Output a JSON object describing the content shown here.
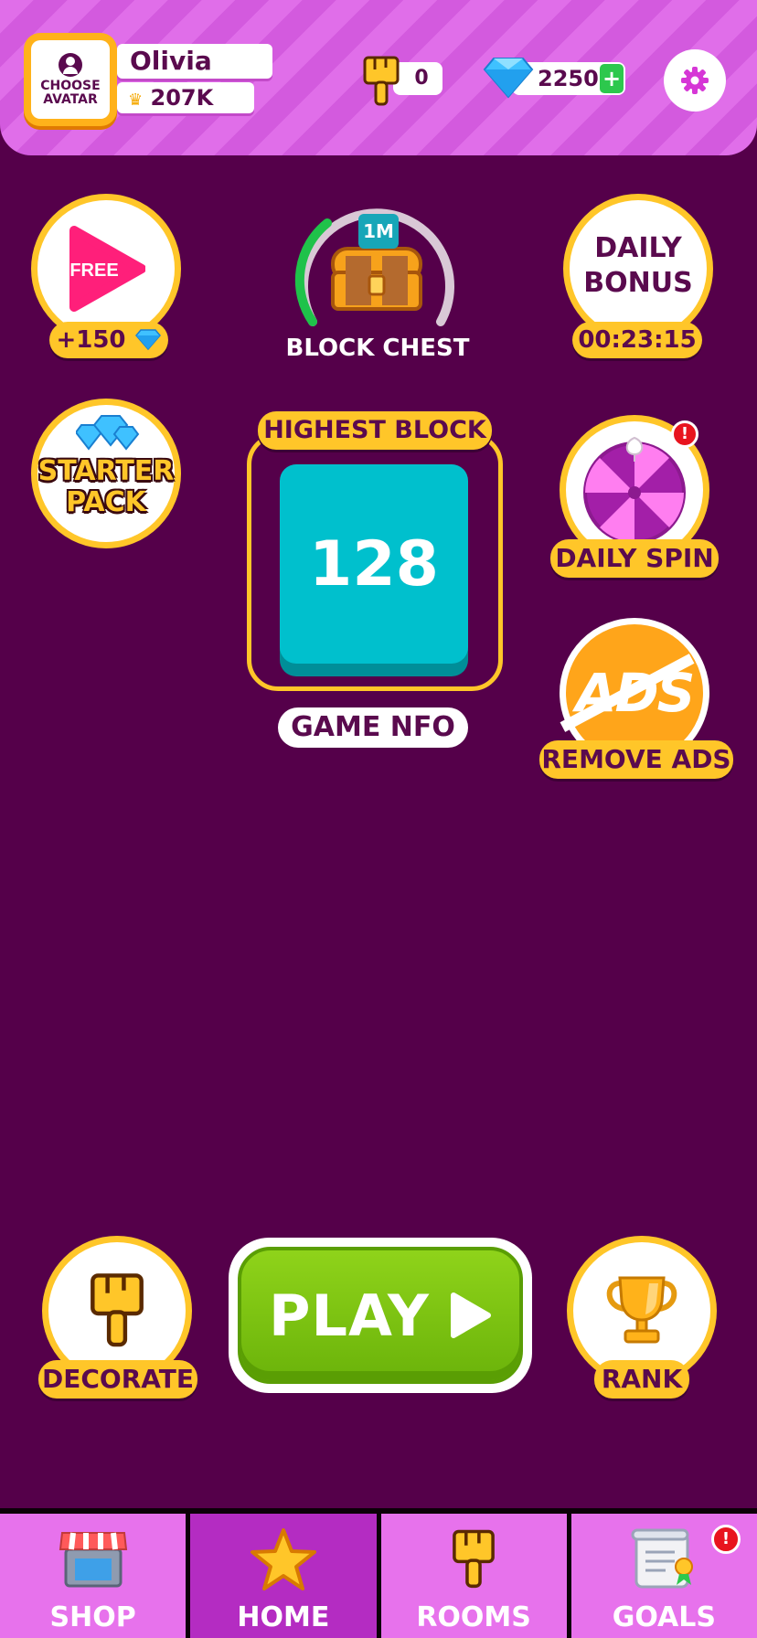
{
  "header": {
    "avatar_label": "CHOOSE AVATAR",
    "player_name": "Olivia",
    "player_score": "207K",
    "brush_count": "0",
    "gem_count": "2250",
    "gem_plus": "+"
  },
  "rewards": {
    "free_video_label": "FREE",
    "free_video_reward": "+150",
    "block_chest_value": "1M",
    "block_chest_label": "BLOCK CHEST",
    "daily_bonus_label_line1": "DAILY",
    "daily_bonus_label_line2": "BONUS",
    "daily_bonus_timer": "00:23:15",
    "starter_pack_line1": "STARTER",
    "starter_pack_line2": "PACK",
    "daily_spin_label": "DAILY SPIN",
    "daily_spin_alert": "!",
    "remove_ads_icon_text": "ADS",
    "remove_ads_label": "REMOVE ADS"
  },
  "highest_block": {
    "label": "HIGHEST BLOCK",
    "value": "128",
    "game_info_label": "GAME NFO"
  },
  "actions": {
    "decorate_label": "DECORATE",
    "play_label": "PLAY",
    "rank_label": "RANK"
  },
  "nav": {
    "items": [
      {
        "label": "SHOP",
        "icon": "shop-icon",
        "active": false
      },
      {
        "label": "HOME",
        "icon": "star-icon",
        "active": true
      },
      {
        "label": "ROOMS",
        "icon": "brush-icon",
        "active": false
      },
      {
        "label": "GOALS",
        "icon": "scroll-icon",
        "active": false
      }
    ],
    "goals_alert": "!"
  },
  "colors": {
    "background": "#55004a",
    "header": "#e06ee9",
    "accent_yellow": "#ffc629",
    "block_teal": "#00c0cd",
    "play_green": "#7bc20f",
    "nav_active": "#b42cc2"
  }
}
